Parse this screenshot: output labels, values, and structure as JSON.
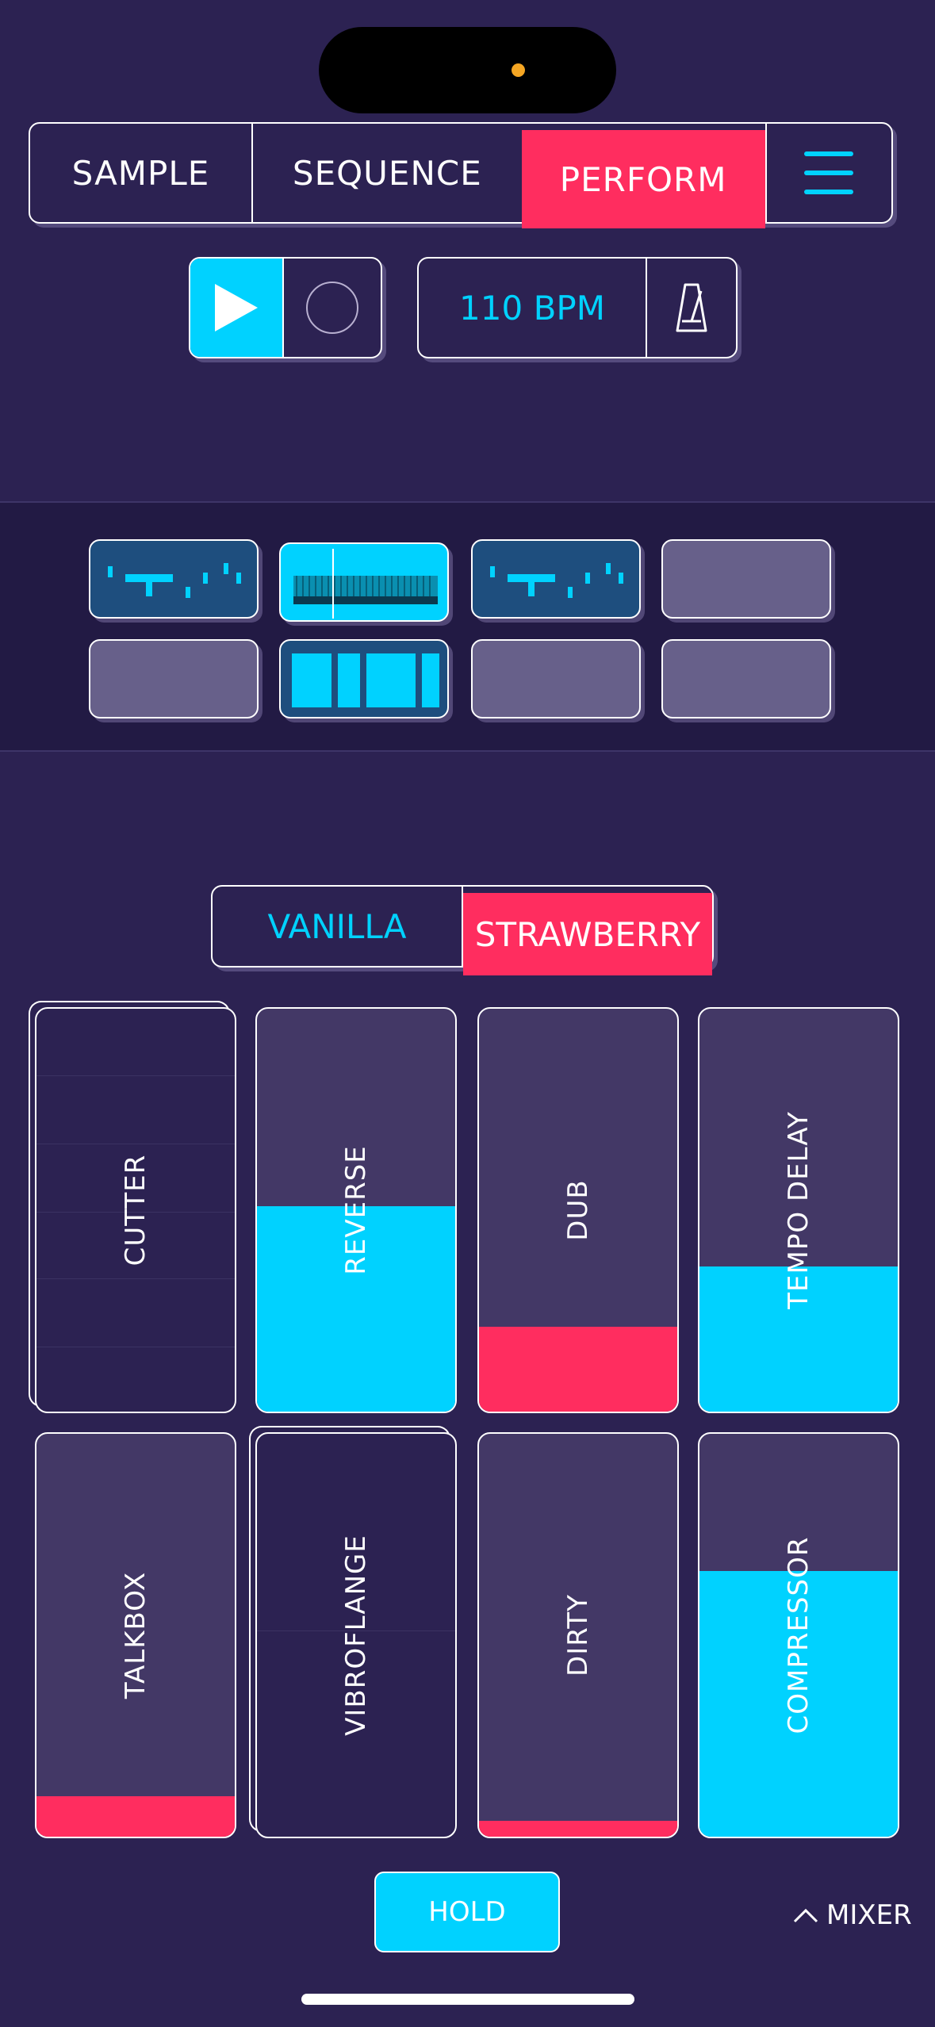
{
  "mode_tabs": {
    "sample": "SAMPLE",
    "sequence": "SEQUENCE",
    "perform": "PERFORM",
    "active": "PERFORM"
  },
  "transport": {
    "bpm_label": "110 BPM",
    "play_icon": "play-icon",
    "record_icon": "record-icon",
    "metronome_icon": "metronome-icon"
  },
  "patterns": {
    "row1": [
      "pattern",
      "active-sample",
      "pattern",
      "empty"
    ],
    "row2": [
      "empty",
      "pattern-blocks",
      "empty",
      "empty"
    ]
  },
  "flavor_toggle": {
    "vanilla": "VANILLA",
    "strawberry": "STRAWBERRY",
    "selected": "STRAWBERRY"
  },
  "fx_pads": [
    {
      "label": "CUTTER",
      "level": 0,
      "color": "#2c2252"
    },
    {
      "label": "REVERSE",
      "level": 0.51,
      "color": "#00d2ff"
    },
    {
      "label": "DUB",
      "level": 0.21,
      "color": "#ff2d5f"
    },
    {
      "label": "TEMPO DELAY",
      "level": 0.36,
      "color": "#00d2ff"
    },
    {
      "label": "TALKBOX",
      "level": 0.1,
      "color": "#ff2d5f"
    },
    {
      "label": "VIBROFLANGE",
      "level": 0,
      "color": "#2c2252"
    },
    {
      "label": "DIRTY",
      "level": 0.04,
      "color": "#ff2d5f"
    },
    {
      "label": "COMPRESSOR",
      "level": 0.66,
      "color": "#00d2ff"
    }
  ],
  "bottom": {
    "hold": "HOLD",
    "mixer": "MIXER",
    "mixer_icon": "chevron-up-icon"
  },
  "colors": {
    "background": "#2c2252",
    "accent_cyan": "#00d2ff",
    "accent_pink": "#ff2d5f"
  }
}
